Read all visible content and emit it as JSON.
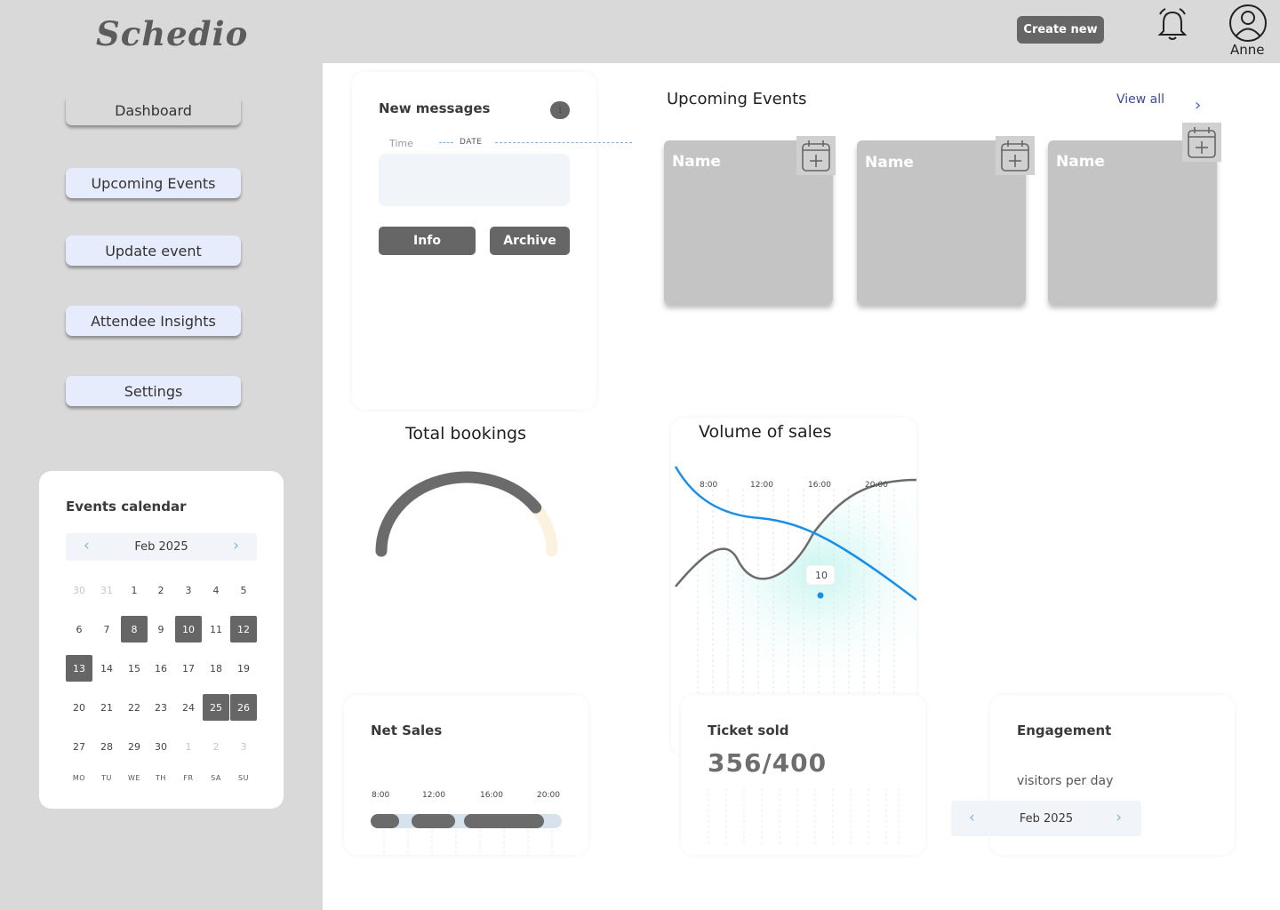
{
  "app": {
    "logo": "Schedio"
  },
  "header": {
    "create_label": "Create new",
    "user_name": "Anne"
  },
  "sidebar": {
    "items": [
      {
        "label": "Dashboard"
      },
      {
        "label": "Upcoming Events"
      },
      {
        "label": "Update event"
      },
      {
        "label": "Attendee Insights"
      },
      {
        "label": "Settings"
      }
    ]
  },
  "calendar": {
    "title": "Events calendar",
    "month": "Feb 2025",
    "prev_icon": "‹",
    "next_icon": "›",
    "weekdays": [
      "MO",
      "TU",
      "WE",
      "TH",
      "FR",
      "SA",
      "SU"
    ],
    "weeks": [
      [
        "30",
        "31",
        "1",
        "2",
        "3",
        "4",
        "5"
      ],
      [
        "6",
        "7",
        "8",
        "9",
        "10",
        "11",
        "12"
      ],
      [
        "13",
        "14",
        "15",
        "16",
        "17",
        "18",
        "19"
      ],
      [
        "20",
        "21",
        "22",
        "23",
        "24",
        "25",
        "26"
      ],
      [
        "27",
        "28",
        "29",
        "30",
        "1",
        "2",
        "3"
      ]
    ],
    "muted": [
      "0-0",
      "0-1",
      "4-4",
      "4-5",
      "4-6"
    ],
    "selected": [
      "8",
      "10",
      "12",
      "13",
      "25",
      "26"
    ]
  },
  "messages": {
    "title": "New messages",
    "badge": "1",
    "time_label": "Time",
    "date_label": "DATE",
    "info_label": "Info",
    "archive_label": "Archive"
  },
  "upcoming": {
    "title": "Upcoming Events",
    "view_all": "View all",
    "view_all_arrow": "›",
    "events": [
      {
        "name": "Name"
      },
      {
        "name": "Name"
      },
      {
        "name": "Name"
      }
    ]
  },
  "bookings": {
    "title": "Total bookings",
    "fill_fraction": 0.8
  },
  "sales": {
    "title": "Volume of sales",
    "times": [
      "8:00",
      "12:00",
      "16:00",
      "20:00"
    ],
    "tooltip": "10"
  },
  "net_sales": {
    "title": "Net Sales",
    "times": [
      "8:00",
      "12:00",
      "16:00",
      "20:00"
    ]
  },
  "tickets": {
    "title": "Ticket sold",
    "value": "356/400"
  },
  "engagement": {
    "title": "Engagement",
    "subtitle": "visitors per day",
    "month": "Feb 2025",
    "prev_icon": "‹",
    "next_icon": "›"
  },
  "colors": {
    "accent_blue": "#1a8fe8",
    "dark_gray": "#666666",
    "sidebar_bg": "#d9d9d9",
    "nav_button_bg": "#e6ecfb"
  }
}
